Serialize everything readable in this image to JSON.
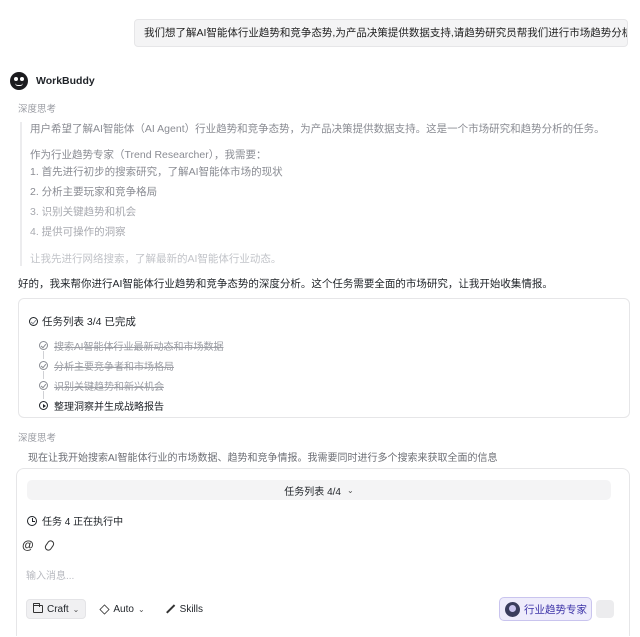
{
  "user_message": "我们想了解AI智能体行业趋势和竞争态势,为产品决策提供数据支持,请趋势研究员帮我们进行市场趋势分析。",
  "agent": {
    "name": "WorkBuddy"
  },
  "thinking": {
    "label": "深度思考",
    "intro": "用户希望了解AI智能体（AI Agent）行业趋势和竞争态势，为产品决策提供数据支持。这是一个市场研究和趋势分析的任务。",
    "role": "作为行业趋势专家（Trend Researcher），我需要：",
    "steps": [
      "1. 首先进行初步的搜索研究，了解AI智能体市场的现状",
      "2. 分析主要玩家和竞争格局",
      "3. 识别关键趋势和机会",
      "4. 提供可操作的洞察"
    ],
    "next": "让我先进行网络搜索，了解最新的AI智能体行业动态。"
  },
  "response": "好的，我来帮你进行AI智能体行业趋势和竞争态势的深度分析。这个任务需要全面的市场研究，让我开始收集情报。",
  "task_list": {
    "title": "任务列表 3/4 已完成",
    "items": [
      {
        "label": "搜索AI智能体行业最新动态和市场数据",
        "status": "done"
      },
      {
        "label": "分析主要竞争者和市场格局",
        "status": "done"
      },
      {
        "label": "识别关键趋势和新兴机会",
        "status": "done"
      },
      {
        "label": "整理洞察并生成战略报告",
        "status": "active"
      }
    ]
  },
  "deep_thinking": {
    "label": "深度思考",
    "text": "现在让我开始搜索AI智能体行业的市场数据、趋势和竞争情报。我需要同时进行多个搜索来获取全面的信息"
  },
  "input_panel": {
    "task_pill": "任务列表 4/4",
    "exec_status": "任务 4 正在执行中",
    "placeholder": "输入消息...",
    "toolbar": {
      "craft": "Craft",
      "auto": "Auto",
      "skills": "Skills"
    },
    "expert_button": "行业趋势专家"
  }
}
